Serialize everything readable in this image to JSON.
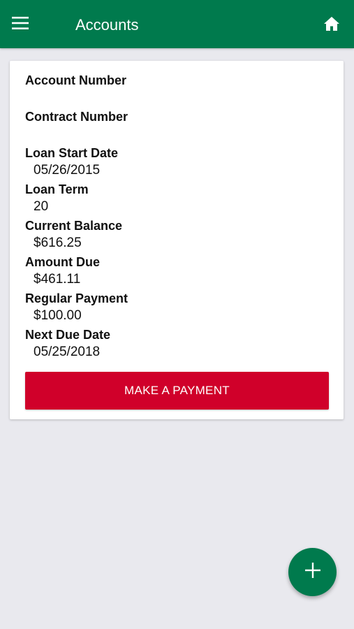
{
  "header": {
    "title": "Accounts",
    "menu_icon": "hamburger-menu-icon",
    "home_icon": "home-icon"
  },
  "account": {
    "fields": [
      {
        "label": "Account Number",
        "value": ""
      },
      {
        "label": "Contract Number",
        "value": ""
      },
      {
        "label": "Loan Start Date",
        "value": "05/26/2015"
      },
      {
        "label": "Loan Term",
        "value": "20"
      },
      {
        "label": "Current Balance",
        "value": "$616.25"
      },
      {
        "label": "Amount Due",
        "value": "$461.11"
      },
      {
        "label": "Regular Payment",
        "value": "$100.00"
      },
      {
        "label": "Next Due Date",
        "value": "05/25/2018"
      }
    ],
    "payment_button_label": "MAKE A PAYMENT"
  },
  "fab": {
    "icon": "plus-icon"
  },
  "colors": {
    "primary": "#007a4d",
    "accent": "#d0002a",
    "background": "#e9e9ee"
  }
}
